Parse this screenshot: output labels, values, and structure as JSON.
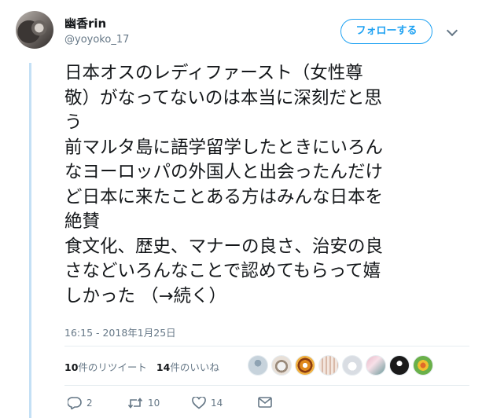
{
  "header": {
    "display_name": "幽香rin",
    "handle": "@yoyoko_17",
    "follow_label": "フォローする"
  },
  "tweet": {
    "lines": [
      "日本オスのレディファースト（女性尊",
      "敬）がなってないのは本当に深刻だと思",
      "う",
      "前マルタ島に語学留学したときにいろん",
      "なヨーロッパの外国人と出会ったんだけ",
      "ど日本に来たことある方はみんな日本を",
      "絶賛",
      "食文化、歴史、マナーの良さ、治安の良",
      "さなどいろんなことで認めてもらって嬉",
      "しかった （→続く）"
    ],
    "timestamp": "16:15 - 2018年1月25日"
  },
  "stats": {
    "retweet_count": "10",
    "retweet_label": "件のリツイート",
    "like_count": "14",
    "like_label": "件のいいね"
  },
  "actions": {
    "reply_count": "2",
    "retweet_count": "10",
    "like_count": "14"
  },
  "colors": {
    "accent": "#1da1f2",
    "secondary_text": "#657786",
    "thread_line": "#c4e0f5"
  }
}
